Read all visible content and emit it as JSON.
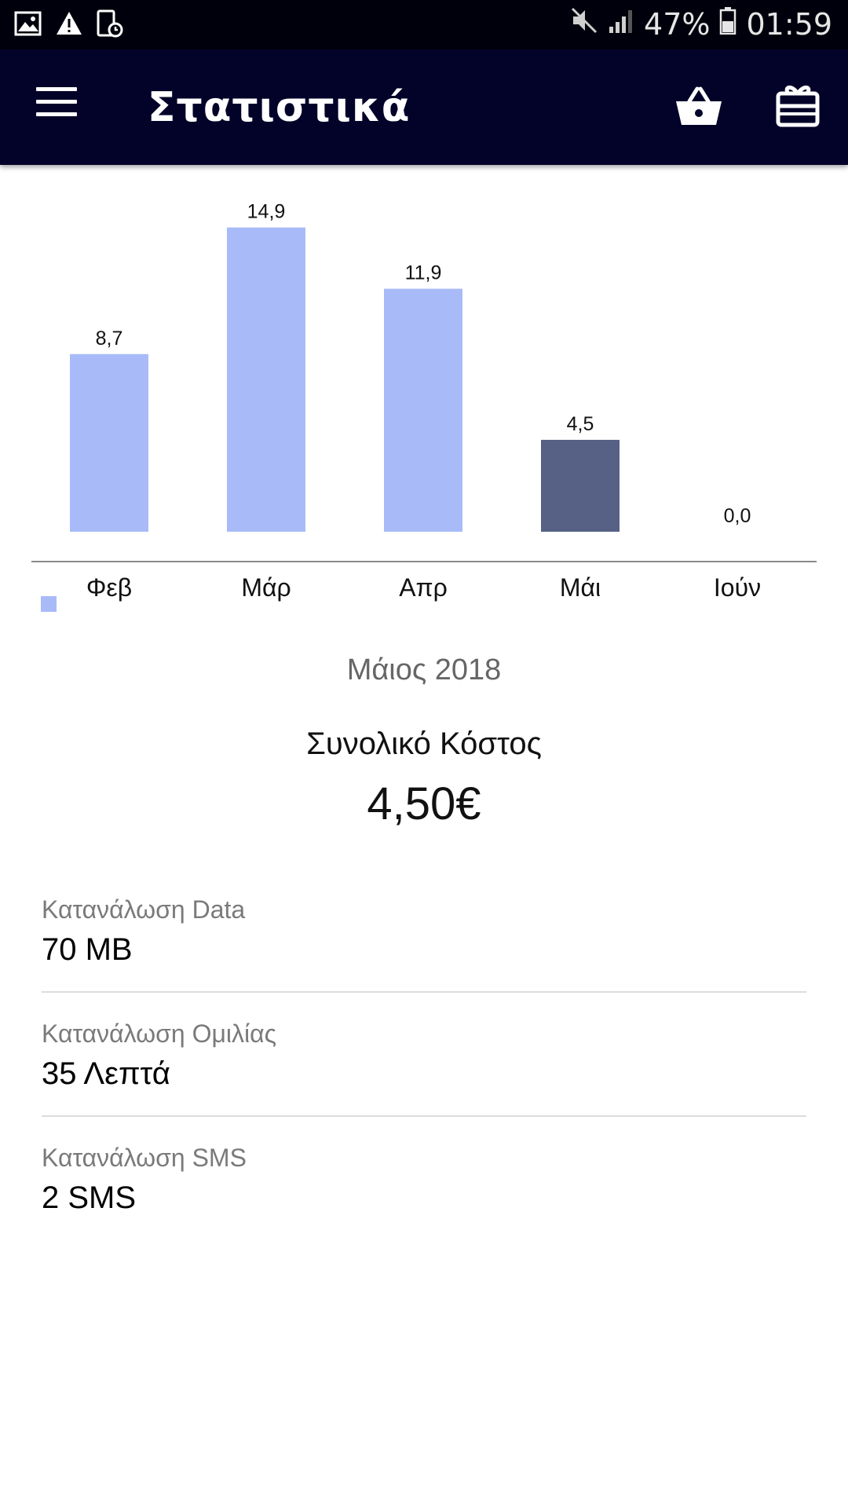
{
  "status_bar": {
    "battery": "47%",
    "time": "01:59",
    "icons": [
      "image-icon",
      "warning-icon",
      "device-lock-icon",
      "mute-icon",
      "signal-icon",
      "battery-icon"
    ]
  },
  "app_bar": {
    "title": "Στατιστικά",
    "icons": [
      "menu-icon",
      "basket-icon",
      "gift-card-icon"
    ]
  },
  "colors": {
    "status_bar_bg": "#00000c",
    "app_bar_bg": "#03032a",
    "bar_default": "#a8bbf8",
    "bar_selected": "#566185"
  },
  "chart_data": {
    "type": "bar",
    "categories": [
      "Φεβ",
      "Μάρ",
      "Απρ",
      "Μάι",
      "Ιούν"
    ],
    "values": [
      8.7,
      14.9,
      11.9,
      4.5,
      0.0
    ],
    "value_labels": [
      "8,7",
      "14,9",
      "11,9",
      "4,5",
      "0,0"
    ],
    "selected_index": 3,
    "ylim": [
      0,
      16
    ],
    "grid": false,
    "legend": "bottom-left"
  },
  "summary": {
    "month": "Μάιος 2018",
    "total_cost_label": "Συνολικό Κόστος",
    "total_cost_value": "4,50€"
  },
  "stats": [
    {
      "label": "Κατανάλωση Data",
      "value": "70 MB"
    },
    {
      "label": "Κατανάλωση Ομιλίας",
      "value": "35 Λεπτά"
    },
    {
      "label": "Κατανάλωση SMS",
      "value": "2 SMS"
    }
  ]
}
